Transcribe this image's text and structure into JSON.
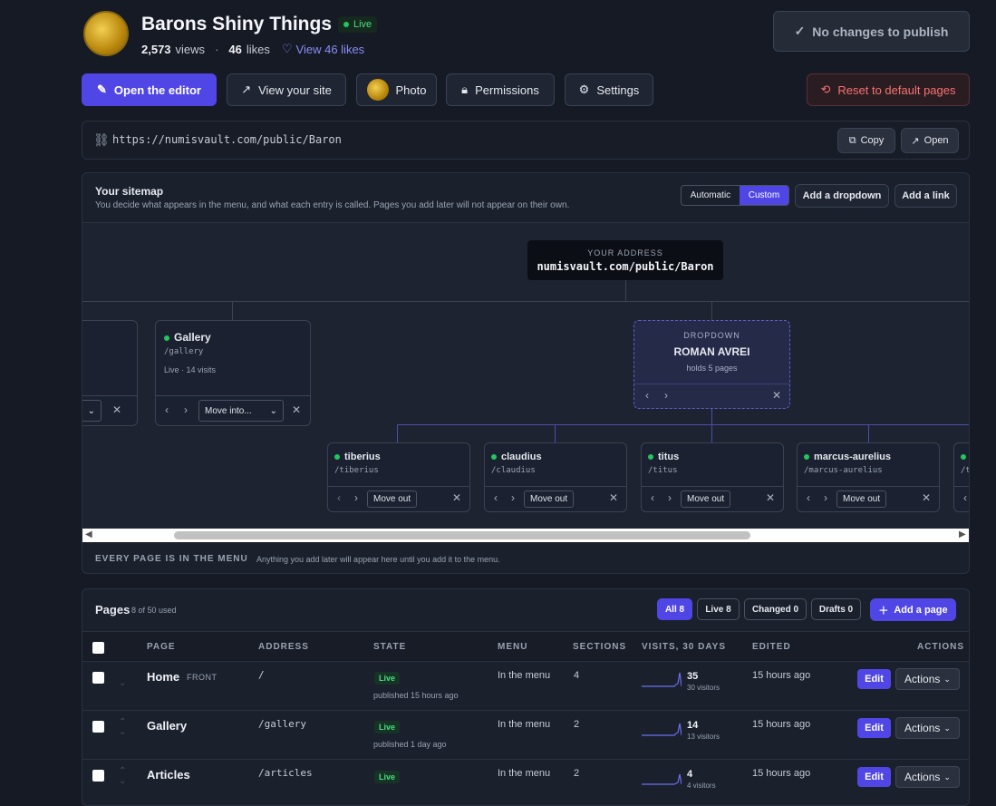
{
  "site": {
    "title": "Barons Shiny Things",
    "live_label": "Live",
    "views": "2,573",
    "views_label": "views",
    "likes": "46",
    "likes_label": "likes",
    "view_likes": "View 46 likes"
  },
  "publish": {
    "label": "No changes to publish"
  },
  "toolbar": {
    "open_editor": "Open the editor",
    "view_site": "View your site",
    "photo": "Photo",
    "permissions": "Permissions",
    "settings": "Settings",
    "reset": "Reset to default pages"
  },
  "url_bar": {
    "url": "https://numisvault.com/public/Baron",
    "copy": "Copy",
    "open": "Open"
  },
  "sitemap": {
    "title": "Your sitemap",
    "subtitle": "You decide what appears in the menu, and what each entry is called. Pages you add later will not appear on their own.",
    "mode_automatic": "Automatic",
    "mode_custom": "Custom",
    "add_dropdown": "Add a dropdown",
    "add_link": "Add a link",
    "address_label": "YOUR ADDRESS",
    "address": "numisvault.com/public/Baron",
    "gallery": {
      "name": "Gallery",
      "path": "/gallery",
      "meta": "Live · 14 visits",
      "move_into": "Move into..."
    },
    "dropdown": {
      "label": "DROPDOWN",
      "name": "ROMAN AVREI",
      "holds": "holds 5 pages"
    },
    "children": [
      {
        "name": "tiberius",
        "path": "/tiberius",
        "move": "Move out"
      },
      {
        "name": "claudius",
        "path": "/claudius",
        "move": "Move out"
      },
      {
        "name": "titus",
        "path": "/titus",
        "move": "Move out"
      },
      {
        "name": "marcus-aurelius",
        "path": "/marcus-aurelius",
        "move": "Move out"
      },
      {
        "name": "",
        "path": "/t",
        "move": ""
      }
    ],
    "every_page_title": "EVERY PAGE IS IN THE MENU",
    "every_page_note": "Anything you add later will appear here until you add it to the menu."
  },
  "pages": {
    "title": "Pages",
    "count": "8 of 50 used",
    "filters": {
      "all": "All 8",
      "live": "Live 8",
      "changed": "Changed 0",
      "drafts": "Drafts 0"
    },
    "add_page": "Add a page",
    "columns": {
      "page": "PAGE",
      "address": "ADDRESS",
      "state": "STATE",
      "menu": "MENU",
      "sections": "SECTIONS",
      "visits": "VISITS, 30 DAYS",
      "edited": "EDITED",
      "actions": "ACTIONS"
    },
    "rows": [
      {
        "name": "Home",
        "tag": "FRONT",
        "address": "/",
        "state": "Live",
        "published": "published 15 hours ago",
        "menu": "In the menu",
        "sections": "4",
        "visits": "35",
        "visitors": "30 visitors",
        "edited": "15 hours ago",
        "edit": "Edit",
        "actions": "Actions"
      },
      {
        "name": "Gallery",
        "tag": "",
        "address": "/gallery",
        "state": "Live",
        "published": "published 1 day ago",
        "menu": "In the menu",
        "sections": "2",
        "visits": "14",
        "visitors": "13 visitors",
        "edited": "15 hours ago",
        "edit": "Edit",
        "actions": "Actions"
      },
      {
        "name": "Articles",
        "tag": "",
        "address": "/articles",
        "state": "Live",
        "published": "",
        "menu": "In the menu",
        "sections": "2",
        "visits": "4",
        "visitors": "4 visitors",
        "edited": "15 hours ago",
        "edit": "Edit",
        "actions": "Actions"
      }
    ]
  },
  "colors": {
    "accent": "#5046e5",
    "live": "#22c55e",
    "danger": "#f87171"
  }
}
